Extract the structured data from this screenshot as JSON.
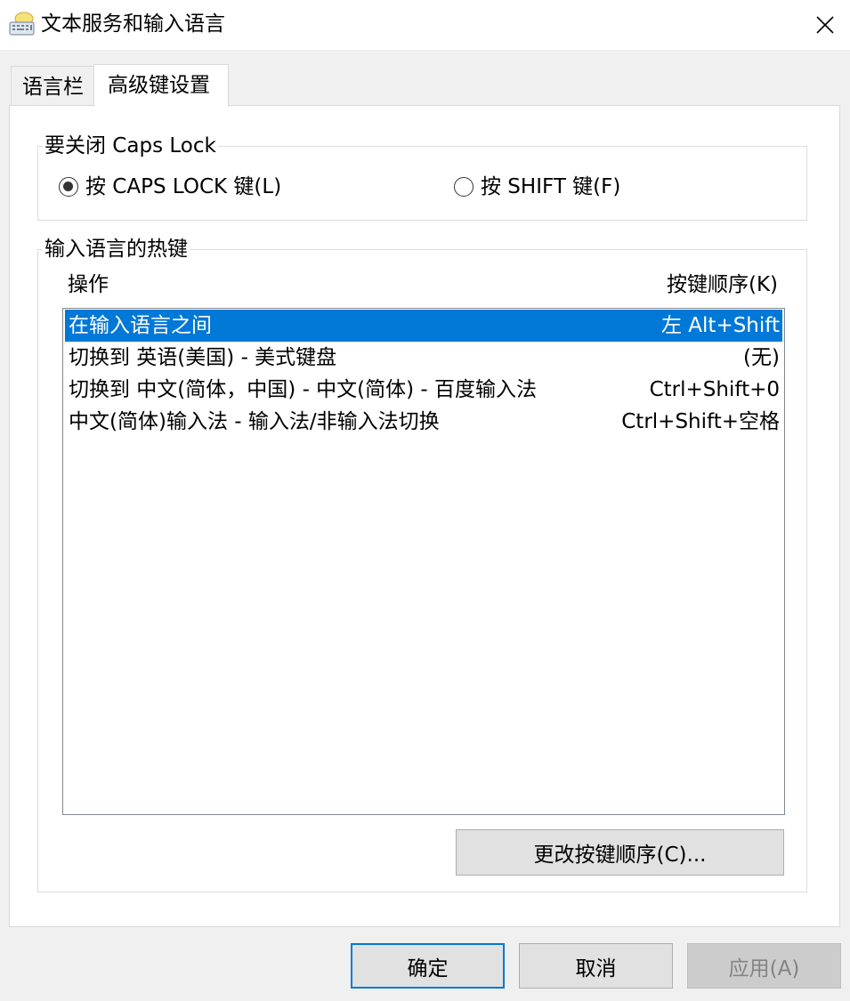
{
  "window": {
    "title": "文本服务和输入语言",
    "icon": "keyboard-icon",
    "close_icon": "close-icon"
  },
  "tabs": [
    {
      "label": "语言栏",
      "active": false
    },
    {
      "label": "高级键设置",
      "active": true
    }
  ],
  "caps_lock": {
    "legend": "要关闭 Caps Lock",
    "options": [
      {
        "label": "按 CAPS LOCK 键(L)",
        "checked": true
      },
      {
        "label": "按 SHIFT 键(F)",
        "checked": false
      }
    ]
  },
  "hotkeys": {
    "legend": "输入语言的热键",
    "columns": {
      "action": "操作",
      "key_sequence": "按键顺序(K)"
    },
    "rows": [
      {
        "action": "在输入语言之间",
        "key": "左 Alt+Shift",
        "selected": true
      },
      {
        "action": "切换到 英语(美国) - 美式键盘",
        "key": "(无)",
        "selected": false
      },
      {
        "action": "切换到 中文(简体，中国) - 中文(简体) - 百度输入法",
        "key": "Ctrl+Shift+0",
        "selected": false
      },
      {
        "action": "中文(简体)输入法 - 输入法/非输入法切换",
        "key": "Ctrl+Shift+空格",
        "selected": false
      }
    ],
    "change_button": "更改按键顺序(C)..."
  },
  "footer": {
    "ok": "确定",
    "cancel": "取消",
    "apply": "应用(A)"
  },
  "colors": {
    "selection": "#0078d7",
    "default_button_border": "#0078d7",
    "disabled_text": "#838383"
  }
}
